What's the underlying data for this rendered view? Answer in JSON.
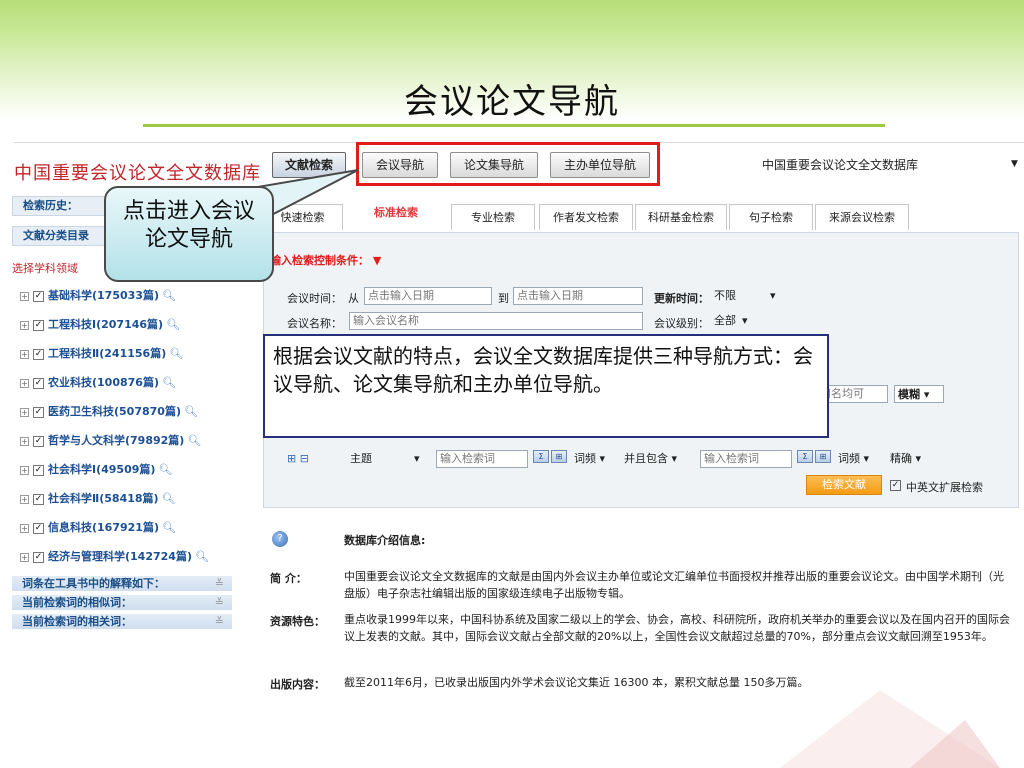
{
  "slide": {
    "title": "会议论文导航"
  },
  "app": {
    "db_title": "中国重要会议论文全文数据库",
    "nav_tabs": [
      "文献检索",
      "会议导航",
      "论文集导航",
      "主办单位导航"
    ],
    "db_select": "中国重要会议论文全文数据库"
  },
  "sidebar": {
    "history": "检索历史：",
    "catalog": "文献分类目录",
    "choose": "选择学科领域",
    "categories": [
      "基础科学(175033篇)",
      "工程科技Ⅰ(207146篇)",
      "工程科技Ⅱ(241156篇)",
      "农业科技(100876篇)",
      "医药卫生科技(507870篇)",
      "哲学与人文科学(79892篇)",
      "社会科学Ⅰ(49509篇)",
      "社会科学Ⅱ(58418篇)",
      "信息科技(167921篇)",
      "经济与管理科学(142724篇)"
    ],
    "bars": [
      "词条在工具书中的解释如下：",
      "当前检索词的相似词：",
      "当前检索词的相关词："
    ]
  },
  "callout": {
    "line1": "点击进入会议",
    "line2": "论文导航"
  },
  "search": {
    "tabs": [
      "快速检索",
      "标准检索",
      "专业检索",
      "作者发文检索",
      "科研基金检索",
      "句子检索",
      "来源会议检索"
    ],
    "cond_title": "输入检索控制条件：",
    "time_label": "会议时间：",
    "from": "从",
    "to": "到",
    "date_ph1": "点击输入日期",
    "date_ph2": "点击输入日期",
    "update_label": "更新时间：",
    "update_val": "不限",
    "name_label": "会议名称：",
    "name_ph": "输入会议名称",
    "level_label": "会议级别：",
    "level_val": "全部",
    "fund_fragment": "用名均可",
    "fuzzy": "模糊",
    "expand": "⊞ ⊟",
    "field": "主题",
    "kw_ph1": "输入检索词",
    "freq1": "词频",
    "logic": "并且包含",
    "kw_ph2": "输入检索词",
    "freq2": "词频",
    "precise": "精确",
    "search_btn": "检索文献",
    "crosslang": "中英文扩展检索"
  },
  "infobox": {
    "text": "根据会议文献的特点，会议全文数据库提供三种导航方式：会议导航、论文集导航和主办单位导航。"
  },
  "dbinfo": {
    "heading": "数据库介绍信息:",
    "intro_label": "简 介：",
    "intro_text": "中国重要会议论文全文数据库的文献是由国内外会议主办单位或论文汇编单位书面授权并推荐出版的重要会议论文。由中国学术期刊（光盘版）电子杂志社编辑出版的国家级连续电子出版物专辑。",
    "feature_label": "资源特色：",
    "feature_text": "重点收录1999年以来，中国科协系统及国家二级以上的学会、协会，高校、科研院所，政府机关举办的重要会议以及在国内召开的国际会议上发表的文献。其中，国际会议文献占全部文献的20%以上，全国性会议文献超过总量的70%，部分重点会议文献回溯至1953年。",
    "content_label": "出版内容：",
    "content_text": "截至2011年6月，已收录出版国内外学术会议论文集近 16300 本，累积文献总量 150多万篇。"
  },
  "colors": {
    "accent_red": "#e21b1b",
    "green_band": "#b5dd77",
    "link_blue": "#1c4f93",
    "orange_button": "#f49c13"
  }
}
